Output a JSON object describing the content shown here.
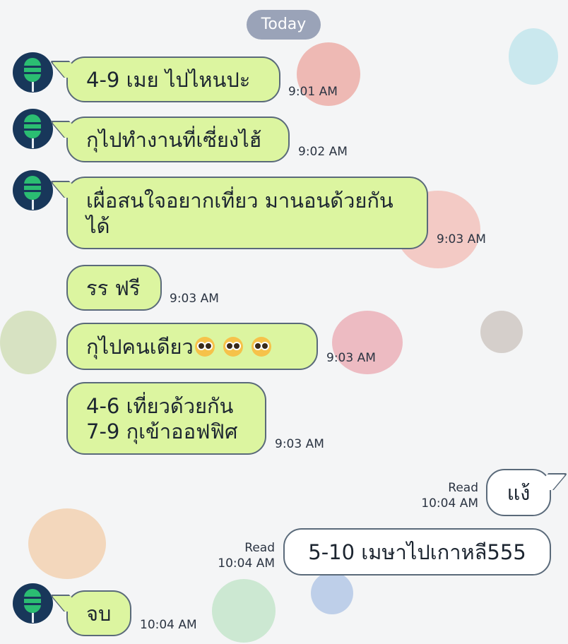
{
  "header": {
    "date_label": "Today"
  },
  "messages": [
    {
      "text": "4-9 เมย ไปไหนปะ",
      "time": "9:01 AM"
    },
    {
      "text": "กุไปทำงานที่เซี่ยงไฮ้",
      "time": "9:02 AM"
    },
    {
      "line1": "เผื่อสนใจอยากเที่ยว มานอนด้วยกัน",
      "line2": "ได้",
      "time": "9:03 AM"
    },
    {
      "text": "รร ฟรี",
      "time": "9:03 AM"
    },
    {
      "text": "กุไปคนเดียว",
      "emoji": "pleading-face",
      "time": "9:03 AM"
    },
    {
      "line1": "4-6 เที่ยวด้วยกัน",
      "line2": "7-9 กุเข้าออฟฟิศ",
      "time": "9:03 AM"
    },
    {
      "text": "แง้",
      "read": "Read",
      "time": "10:04 AM"
    },
    {
      "text": "5-10 เมษาไปเกาหลี555",
      "read": "Read",
      "time": "10:04 AM"
    },
    {
      "text": "จบ",
      "time": "10:04 AM"
    }
  ],
  "colors": {
    "incoming_bubble": "#dcf5a0",
    "outgoing_bubble": "#ffffff",
    "date_pill": "#9aa3b8",
    "avatar_bg": "#18375a"
  }
}
